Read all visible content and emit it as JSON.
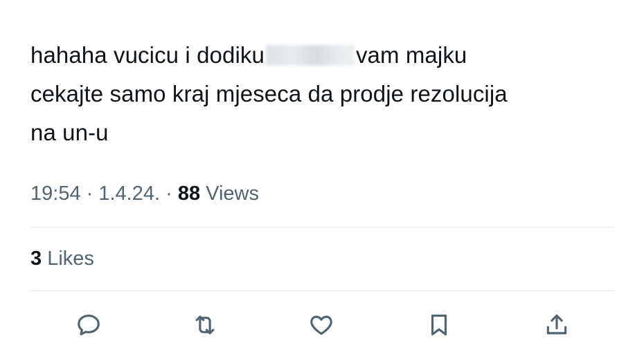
{
  "tweet": {
    "text_line1_before": "hahaha vucicu i dodiku",
    "text_line1_after": "vam majku",
    "text_line2": "cekajte samo kraj mjeseca da prodje rezolucija",
    "text_line3": "na un-u"
  },
  "meta": {
    "time": "19:54",
    "separator1": " · ",
    "date": "1.4.24.",
    "separator2": " · ",
    "views_count": "88",
    "views_label": " Views"
  },
  "engagement": {
    "likes_count": "3",
    "likes_label": " Likes"
  },
  "actions": {
    "reply_icon": "speech-bubble-icon",
    "retweet_icon": "retweet-arrows-icon",
    "like_icon": "heart-icon",
    "bookmark_icon": "bookmark-icon",
    "share_icon": "share-upload-icon"
  },
  "colors": {
    "text_primary": "#0f1419",
    "text_secondary": "#536471",
    "divider": "#e6e9eb"
  }
}
